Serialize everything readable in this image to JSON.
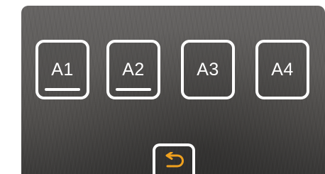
{
  "tiles": [
    {
      "label": "A1",
      "selected": true
    },
    {
      "label": "A2",
      "selected": true
    },
    {
      "label": "A3",
      "selected": false
    },
    {
      "label": "A4",
      "selected": false
    }
  ],
  "back_button": {
    "icon": "return-arrow-icon",
    "color": "#f0a11e"
  },
  "colors": {
    "tile_border": "#ffffff",
    "text": "#ffffff",
    "accent": "#f0a11e"
  }
}
